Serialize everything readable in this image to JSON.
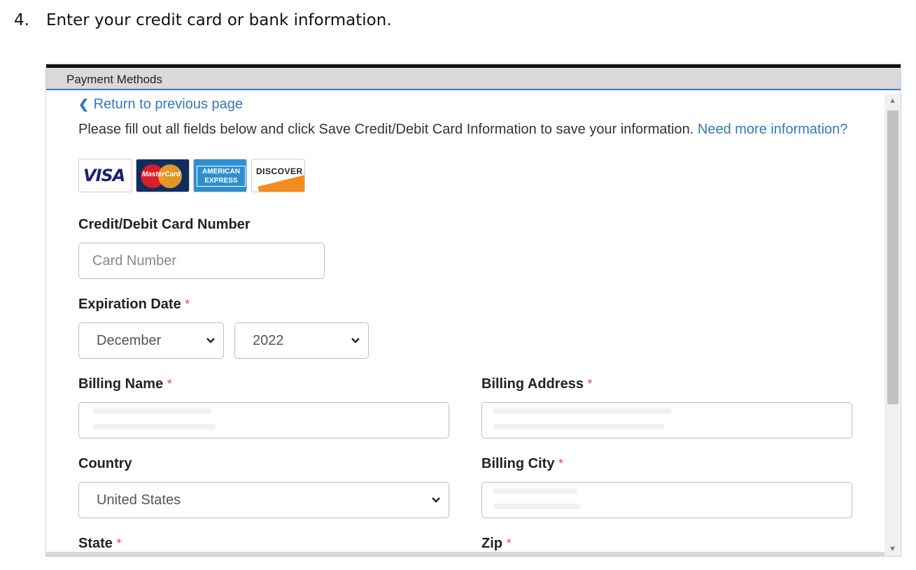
{
  "instruction": {
    "number": "4.",
    "text": "Enter your credit card or bank information."
  },
  "panel": {
    "title": "Payment Methods",
    "back_link": "Return to previous page",
    "intro_text": "Please fill out all fields below and click Save Credit/Debit Card Information to save your information.",
    "need_more_link": "Need more information?",
    "card_logos": [
      "VISA",
      "MasterCard",
      "AMERICAN EXPRESS",
      "DISCOVER"
    ]
  },
  "form": {
    "card_number": {
      "label": "Credit/Debit Card Number",
      "placeholder": "Card Number"
    },
    "expiration": {
      "label": "Expiration Date",
      "required": "*",
      "month": "December",
      "year": "2022"
    },
    "billing_name": {
      "label": "Billing Name",
      "required": "*"
    },
    "billing_address": {
      "label": "Billing Address",
      "required": "*"
    },
    "country": {
      "label": "Country",
      "value": "United States"
    },
    "billing_city": {
      "label": "Billing City",
      "required": "*"
    },
    "state": {
      "label": "State",
      "required": "*"
    },
    "zip": {
      "label": "Zip",
      "required": "*"
    }
  },
  "icons": {
    "back": "chevron-left-icon",
    "select_caret": "chevron-down-icon",
    "scroll_up": "arrow-up-icon",
    "scroll_down": "arrow-down-icon"
  },
  "colors": {
    "link": "#337ab7",
    "required": "#d9534f",
    "header_bg": "#d9d9d9",
    "header_accent": "#2d7cc0"
  }
}
